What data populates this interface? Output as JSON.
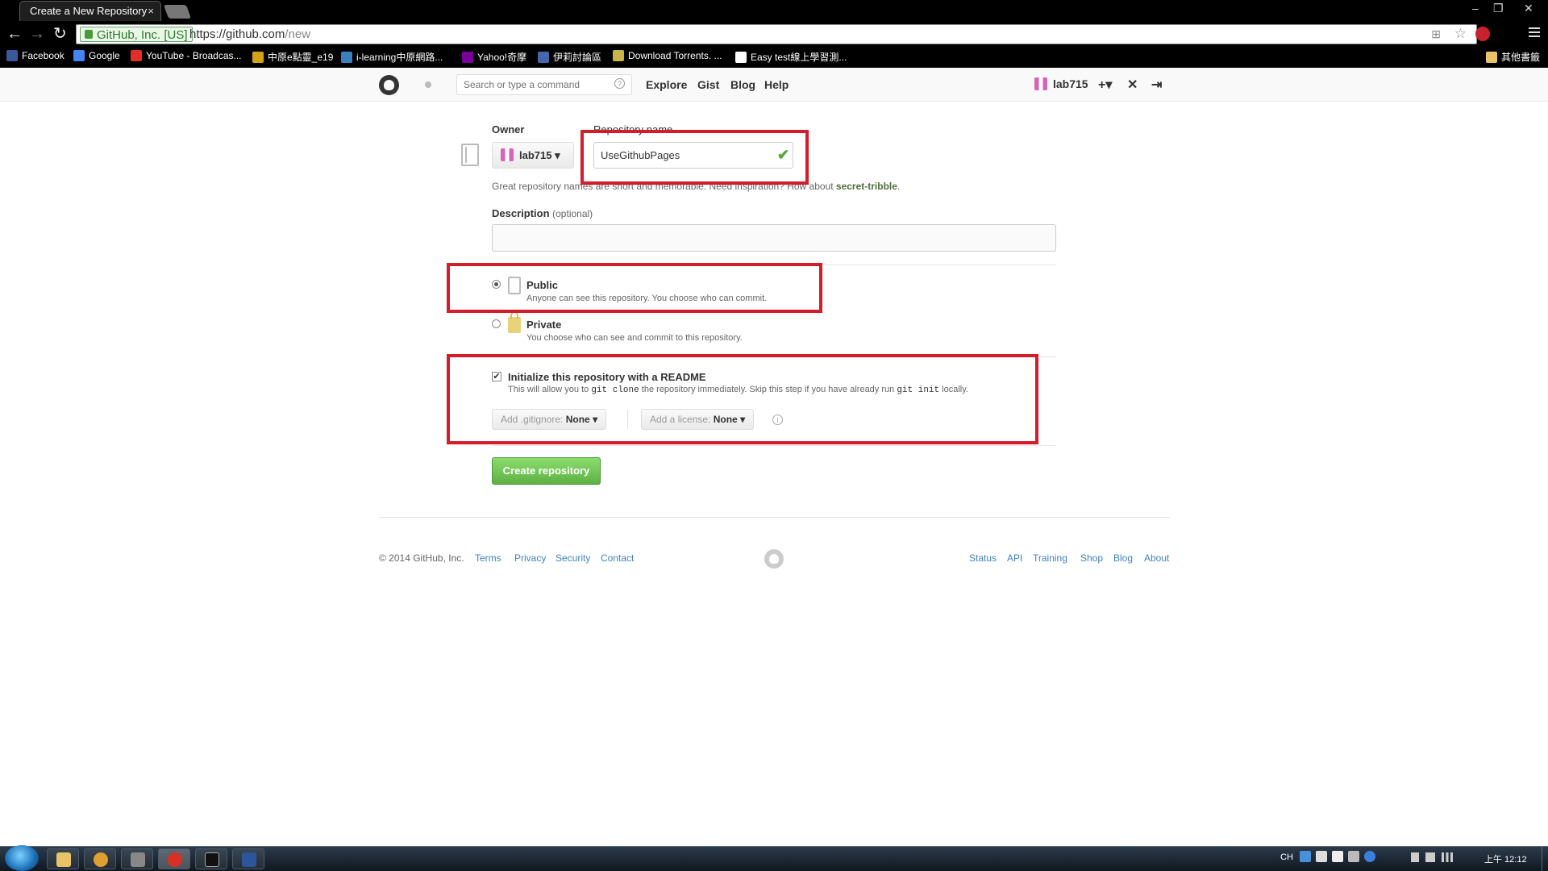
{
  "browser": {
    "tab_title": "Create a New Repository",
    "tab_close": "×",
    "window_controls": [
      "–",
      "❐",
      "✕"
    ],
    "ev_badge": "GitHub, Inc. [US]",
    "url_host": "https://github.com",
    "url_path": "/new",
    "bookmarks": [
      {
        "label": "Facebook",
        "color": "#3b5998"
      },
      {
        "label": "Google",
        "color": "#4285f4"
      },
      {
        "label": "YouTube - Broadcas...",
        "color": "#e52d27"
      },
      {
        "label": "中原e點靈_e19",
        "color": "#d4a017"
      },
      {
        "label": "i-learning中原網路...",
        "color": "#3a7fc0"
      },
      {
        "label": "Yahoo!奇摩",
        "color": "#7b0099"
      },
      {
        "label": "伊莉討論區",
        "color": "#4466aa"
      },
      {
        "label": "Download Torrents. ...",
        "color": "#c9b44a"
      },
      {
        "label": "Easy test線上學習測...",
        "color": "#ffffff"
      }
    ],
    "other_bookmarks": "其他書籤"
  },
  "header": {
    "search_placeholder": "Search or type a command",
    "search_help": "?",
    "nav": [
      "Explore",
      "Gist",
      "Blog",
      "Help"
    ],
    "username": "lab715",
    "new_menu": "+▾",
    "settings_icon": "✕",
    "signout_icon": "⇥"
  },
  "form": {
    "owner_label": "Owner",
    "owner_value": "lab715 ▾",
    "repo_name_label": "Repository name",
    "slash": "/",
    "repo_name_value": "UseGithubPages",
    "check": "✔",
    "hint_text": "Great repository names are short and memorable. Need inspiration? How about ",
    "hint_suggestion": "secret-tribble",
    "hint_end": ".",
    "description_label": "Description",
    "description_optional": "(optional)",
    "public_title": "Public",
    "public_sub": "Anyone can see this repository. You choose who can commit.",
    "private_title": "Private",
    "private_sub": "You choose who can see and commit to this repository.",
    "readme_check": "✔",
    "readme_title": "Initialize this repository with a README",
    "readme_sub_1": "This will allow you to ",
    "readme_code_1": "git clone",
    "readme_sub_2": " the repository immediately. Skip this step if you have already run ",
    "readme_code_2": "git init",
    "readme_sub_3": " locally.",
    "gitignore_label": "Add .gitignore:",
    "gitignore_value": "None ▾",
    "license_label": "Add a license:",
    "license_value": "None ▾",
    "info": "i",
    "create_button": "Create repository"
  },
  "footer": {
    "copyright": "© 2014 GitHub, Inc.",
    "left_links": [
      "Terms",
      "Privacy",
      "Security",
      "Contact"
    ],
    "right_links": [
      "Status",
      "API",
      "Training",
      "Shop",
      "Blog",
      "About"
    ]
  },
  "taskbar": {
    "lang": "CH",
    "time": "上午 12:12"
  },
  "colors": {
    "highlight": "#d51c2a",
    "create_green": "#60b044",
    "link_blue": "#4183c4"
  }
}
